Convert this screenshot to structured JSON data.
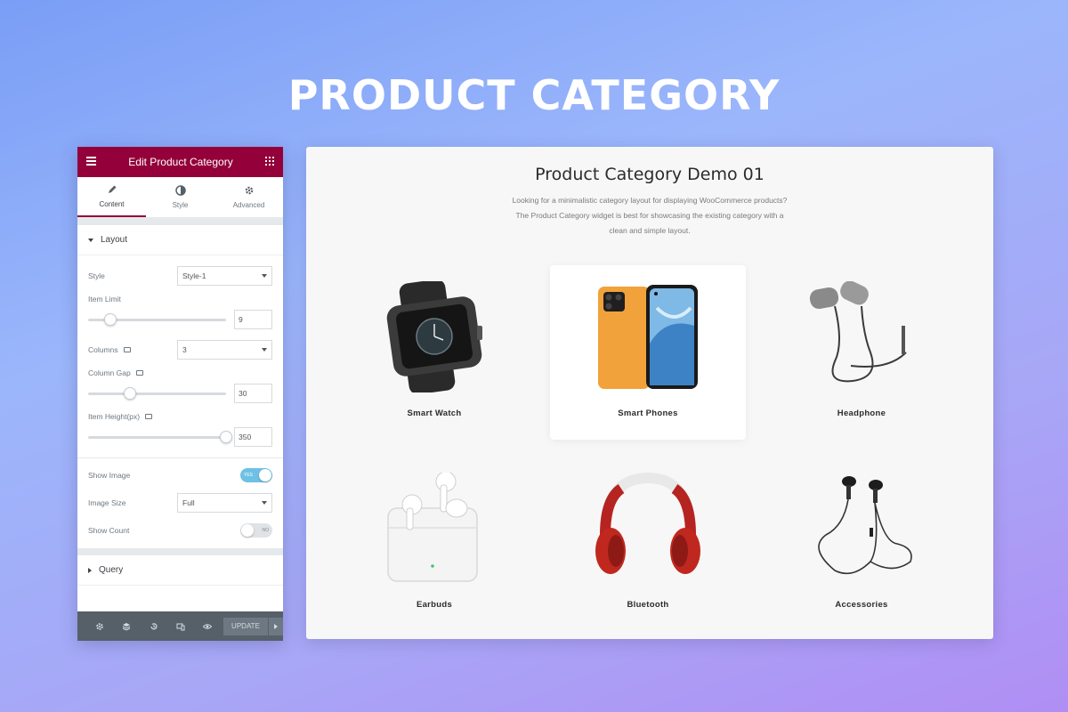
{
  "hero": {
    "title": "PRODUCT CATEGORY"
  },
  "editor": {
    "header_title": "Edit Product Category",
    "tabs": [
      {
        "label": "Content",
        "icon": "pencil-icon",
        "active": true
      },
      {
        "label": "Style",
        "icon": "half-circle-icon",
        "active": false
      },
      {
        "label": "Advanced",
        "icon": "gear-icon",
        "active": false
      }
    ],
    "layout_section": "Layout",
    "style": {
      "label": "Style",
      "value": "Style-1"
    },
    "item_limit": {
      "label": "Item Limit",
      "value": "9",
      "level": 0.16
    },
    "columns": {
      "label": "Columns",
      "value": "3"
    },
    "column_gap": {
      "label": "Column Gap",
      "value": "30",
      "level": 0.3
    },
    "item_height": {
      "label": "Item Height(px)",
      "value": "350",
      "level": 1.0
    },
    "show_image": {
      "label": "Show Image",
      "toggle_text": "YES",
      "on": true
    },
    "image_size": {
      "label": "Image Size",
      "value": "Full"
    },
    "show_count": {
      "label": "Show Count",
      "toggle_text": "NO",
      "on": false
    },
    "query_section": "Query",
    "footer": {
      "update_label": "UPDATE"
    },
    "accent_color": "#93003a"
  },
  "preview": {
    "title": "Product Category Demo 01",
    "description_lines": [
      "Looking for a minimalistic category layout for displaying WooCommerce products?",
      "The Product Category widget is best for showcasing the existing category with a",
      "clean and simple layout."
    ],
    "categories": [
      {
        "name": "Smart Watch",
        "highlighted": false
      },
      {
        "name": "Smart Phones",
        "highlighted": true
      },
      {
        "name": "Headphone",
        "highlighted": false
      },
      {
        "name": "Earbuds",
        "highlighted": false
      },
      {
        "name": "Bluetooth",
        "highlighted": false
      },
      {
        "name": "Accessories",
        "highlighted": false
      }
    ]
  }
}
